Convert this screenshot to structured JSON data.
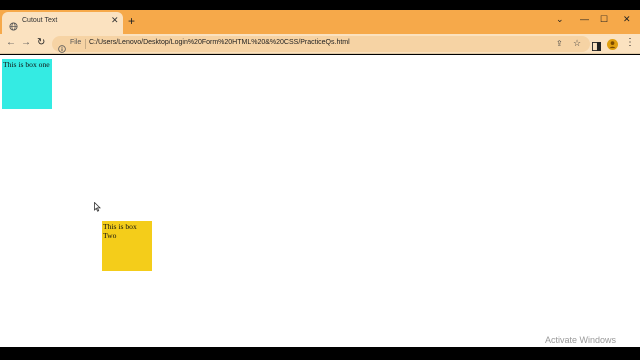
{
  "browser": {
    "tab": {
      "title": "Cutout Text",
      "favicon_icon": "globe-icon",
      "close_glyph": "✕"
    },
    "new_tab_glyph": "+",
    "window_controls": {
      "chevron_glyph": "⌄",
      "minimize_glyph": "—",
      "maximize_glyph": "☐",
      "close_glyph": "✕"
    },
    "nav": {
      "back_glyph": "←",
      "forward_glyph": "→",
      "reload_glyph": "↻"
    },
    "address_bar": {
      "scheme_label": "File",
      "url": "C:/Users/Lenovo/Desktop/Login%20Form%20HTML%20&%20CSS/PracticeQs.html",
      "share_glyph": "⇪",
      "bookmark_glyph": "☆"
    },
    "menu_glyph": "⋮",
    "accent_color": "#f6a94a"
  },
  "page": {
    "box_one": {
      "text": "This is box one",
      "color": "#34ebe3"
    },
    "box_two": {
      "text": "This is box Two",
      "color": "#f4cd1a"
    }
  },
  "overlay": {
    "watermark": "Activate Windows"
  }
}
